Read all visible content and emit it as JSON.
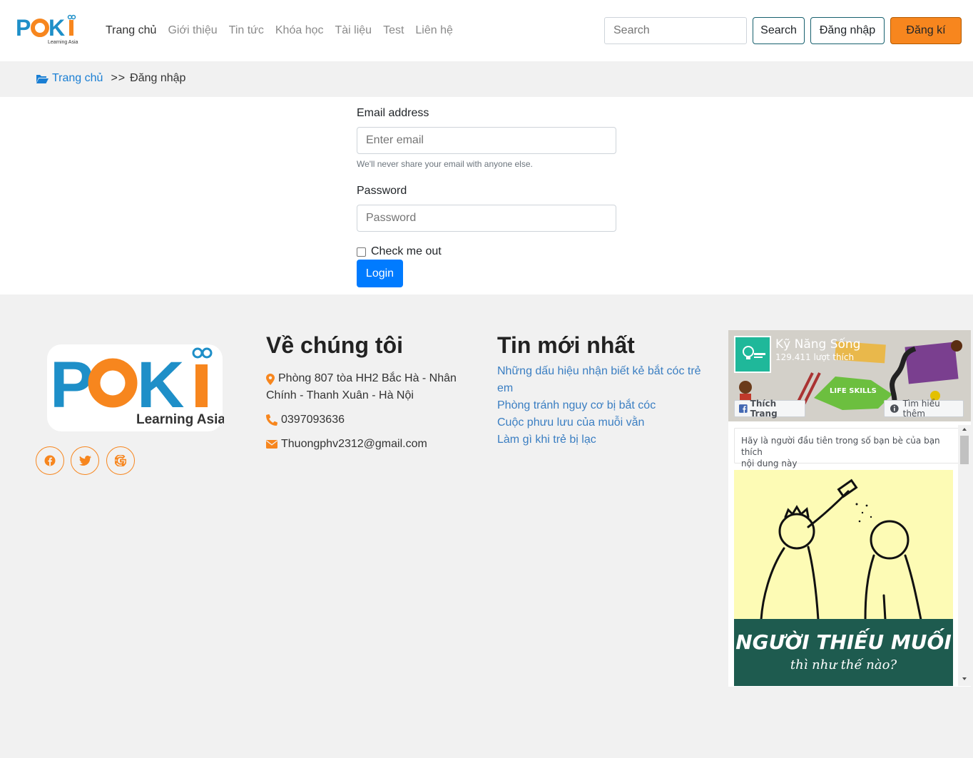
{
  "header": {
    "logo_text": "POKI",
    "logo_sub": "Learning Asia",
    "nav": [
      "Trang chủ",
      "Giới thiệu",
      "Tin tức",
      "Khóa học",
      "Tài liệu",
      "Test",
      "Liên hệ"
    ],
    "search_placeholder": "Search",
    "search_button": "Search",
    "login_button": "Đăng nhập",
    "register_button": "Đăng kí"
  },
  "breadcrumb": {
    "home": "Trang chủ",
    "separator": ">>",
    "current": "Đăng nhập"
  },
  "form": {
    "email_label": "Email address",
    "email_placeholder": "Enter email",
    "email_help": "We'll never share your email with anyone else.",
    "password_label": "Password",
    "password_placeholder": "Password",
    "checkbox_label": "Check me out",
    "submit": "Login"
  },
  "footer": {
    "logo_text": "POKI",
    "logo_sub": "Learning Asia",
    "about_title": "Về chúng tôi",
    "address_line1": "Phòng 807 tòa HH2 Bắc Hà - Nhân",
    "address_line2": "Chính - Thanh Xuân - Hà Nội",
    "phone": "0397093636",
    "email": "Thuongphv2312@gmail.com",
    "news_title": "Tin mới nhất",
    "news": [
      "Những dấu hiệu nhận biết kẻ bắt cóc trẻ",
      "em",
      "Phòng tránh nguy cơ bị bắt cóc",
      "Cuộc phưu lưu của muỗi vằn",
      "Làm gì khi trẻ bị lạc"
    ]
  },
  "facebook": {
    "page_name": "Kỹ Năng Sống",
    "likes": "129.411 lượt thích",
    "like_button": "Thích Trang",
    "learn_more": "Tìm hiểu thêm",
    "first_friend_line1": "Hãy là người đầu tiên trong số bạn bè của bạn thích",
    "first_friend_line2": "nội dung này",
    "cover_label": "LIFE SKILLS",
    "post_title": "NGƯỜI THIẾU MUỐI",
    "post_subtitle": "thì như thế nào?"
  },
  "colors": {
    "brand_orange": "#f7861e",
    "brand_blue": "#1e8fc8",
    "primary": "#007bff",
    "link": "#3a7ec2"
  }
}
